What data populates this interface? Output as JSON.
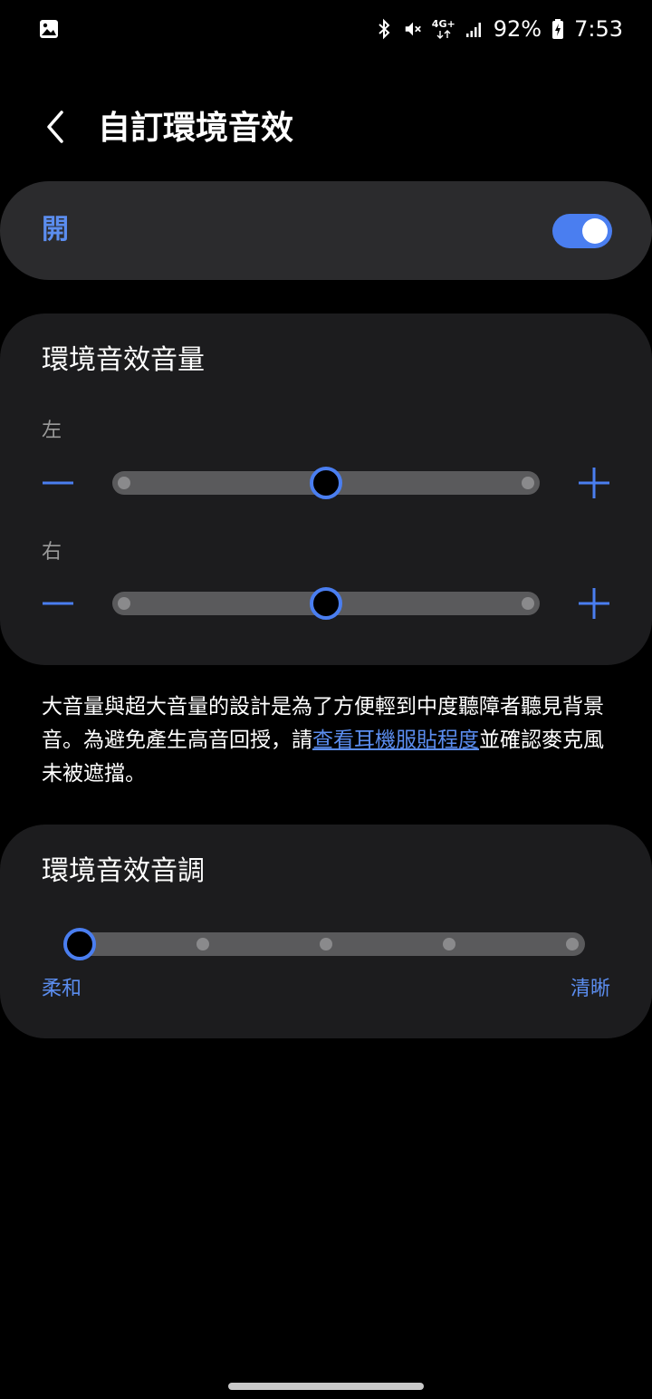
{
  "status_bar": {
    "battery": "92%",
    "time": "7:53",
    "network_label": "4G+",
    "icons": [
      "gallery-icon",
      "bluetooth-icon",
      "mute-icon",
      "network-4g-icon",
      "signal-icon",
      "battery-charging-icon"
    ]
  },
  "header": {
    "title": "自訂環境音效"
  },
  "master": {
    "label": "開",
    "enabled": true
  },
  "volume": {
    "title": "環境音效音量",
    "left_label": "左",
    "right_label": "右",
    "left_level": 0.5,
    "right_level": 0.5
  },
  "description": {
    "before_link": "大音量與超大音量的設計是為了方便輕到中度聽障者聽見背景音。為避免產生高音回授，請",
    "link_text": "查看耳機服貼程度",
    "after_link": "並確認麥克風未被遮擋。"
  },
  "tone": {
    "title": "環境音效音調",
    "min_label": "柔和",
    "max_label": "清晰",
    "level": 0,
    "steps": 5
  },
  "colors": {
    "accent": "#4a7ef0",
    "card": "#1c1c1e",
    "master_card": "#2b2b2d",
    "background": "#000000"
  }
}
